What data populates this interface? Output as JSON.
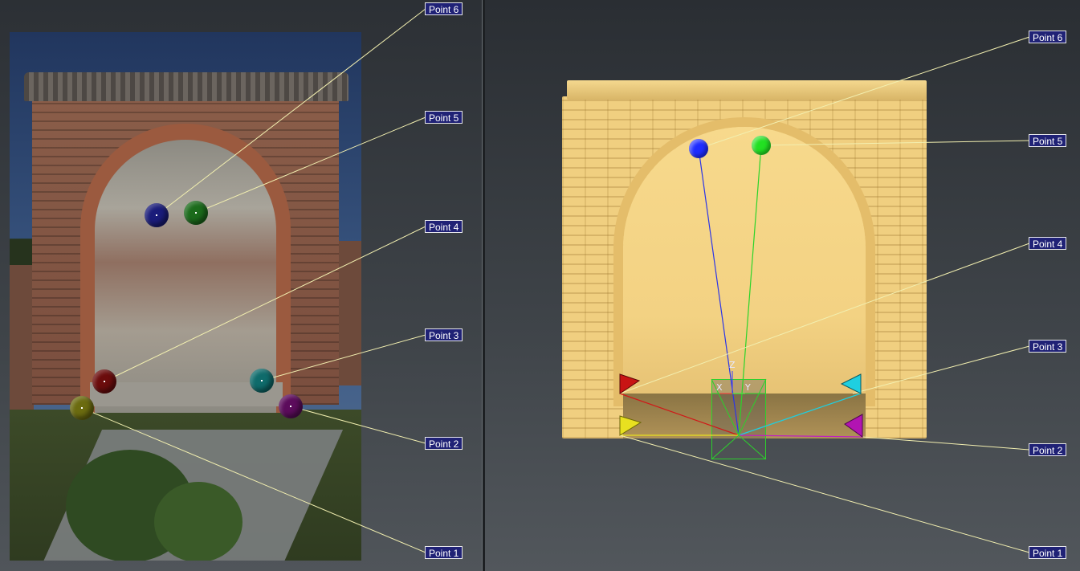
{
  "left_view": {
    "labels": [
      "Point 6",
      "Point 5",
      "Point 4",
      "Point 3",
      "Point 2",
      "Point 1"
    ],
    "markers": [
      {
        "name": "Point 6",
        "color": "#1a1c7a"
      },
      {
        "name": "Point 5",
        "color": "#1b6b1b"
      },
      {
        "name": "Point 4",
        "color": "#6b0c0c"
      },
      {
        "name": "Point 3",
        "color": "#0f6b6b"
      },
      {
        "name": "Point 2",
        "color": "#5c0c5c"
      },
      {
        "name": "Point 1",
        "color": "#6b6b10"
      }
    ]
  },
  "right_view": {
    "labels": [
      "Point 6",
      "Point 5",
      "Point 4",
      "Point 3",
      "Point 2",
      "Point 1"
    ],
    "markers": [
      {
        "name": "Point 6",
        "color": "#1e2cff"
      },
      {
        "name": "Point 5",
        "color": "#22e022"
      },
      {
        "name": "Point 4",
        "color": "#c81414"
      },
      {
        "name": "Point 3",
        "color": "#1ecfe0"
      },
      {
        "name": "Point 2",
        "color": "#b214b2"
      },
      {
        "name": "Point 1",
        "color": "#e8e020"
      }
    ],
    "gizmo_axes": [
      "Z",
      "X",
      "Y"
    ]
  },
  "colors": {
    "label_bg": "#202276",
    "leader_line": "#f2efb0",
    "model_color": "#f0cf80"
  }
}
